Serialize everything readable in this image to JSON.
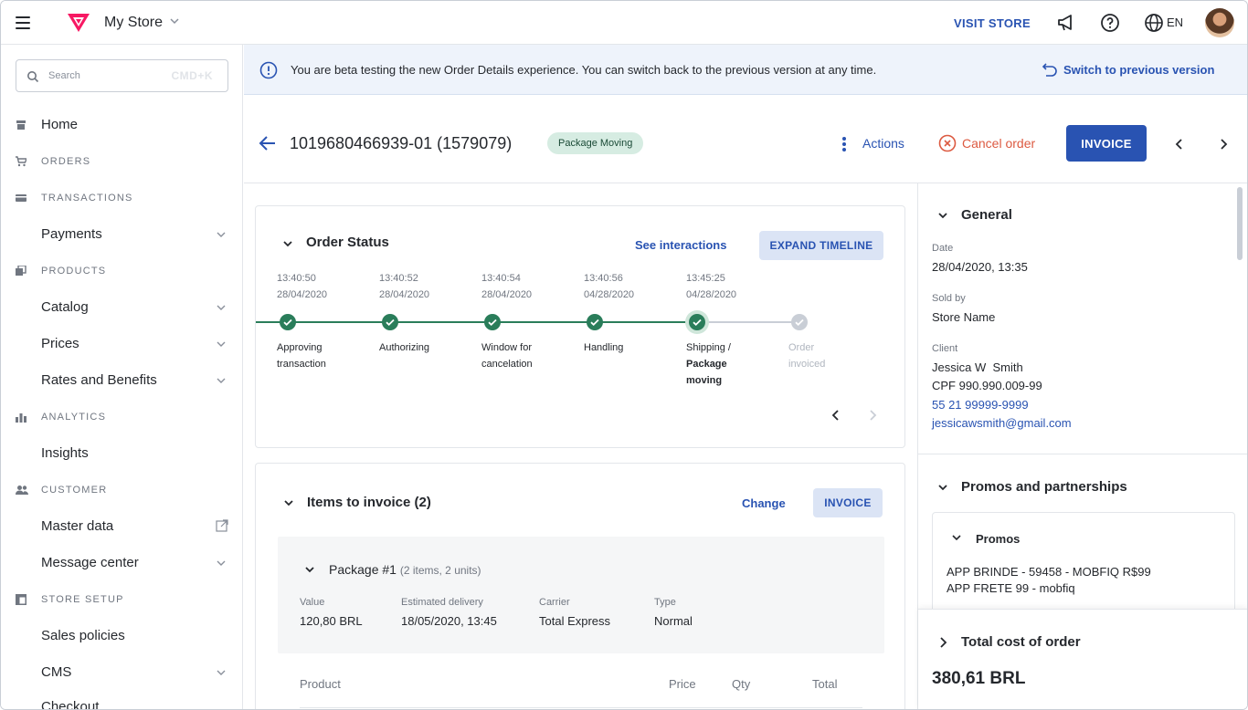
{
  "topbar": {
    "store_name": "My Store",
    "visit_store": "VISIT STORE",
    "lang": "EN"
  },
  "sidebar": {
    "search_placeholder": "Search",
    "search_shortcut": "CMD+K",
    "home": "Home",
    "sections": {
      "orders": "ORDERS",
      "transactions": "TRANSACTIONS",
      "products": "PRODUCTS",
      "analytics": "ANALYTICS",
      "customer": "CUSTOMER",
      "store_setup": "STORE SETUP"
    },
    "items": {
      "payments": "Payments",
      "catalog": "Catalog",
      "prices": "Prices",
      "rates": "Rates and Benefits",
      "insights": "Insights",
      "master_data": "Master data",
      "message_center": "Message center",
      "sales_policies": "Sales policies",
      "cms": "CMS",
      "checkout": "Checkout"
    }
  },
  "banner": {
    "message": "You are beta testing the new Order Details experience. You can switch back to the previous version at any time.",
    "switch_label": "Switch to previous version"
  },
  "header": {
    "order_id": "1019680466939-01 (1579079)",
    "status": "Package Moving",
    "actions": "Actions",
    "cancel": "Cancel order",
    "invoice": "INVOICE"
  },
  "order_status": {
    "title": "Order Status",
    "see_interactions": "See interactions",
    "expand_timeline": "EXPAND TIMELINE",
    "steps": [
      {
        "time": "13:40:50",
        "date": "28/04/2020",
        "label1": "Approving",
        "label2": "transaction",
        "label3": ""
      },
      {
        "time": "13:40:52",
        "date": "28/04/2020",
        "label1": "Authorizing",
        "label2": "",
        "label3": ""
      },
      {
        "time": "13:40:54",
        "date": "28/04/2020",
        "label1": "Window for",
        "label2": "cancelation",
        "label3": ""
      },
      {
        "time": "13:40:56",
        "date": "04/28/2020",
        "label1": "Handling",
        "label2": "",
        "label3": ""
      },
      {
        "time": "13:45:25",
        "date": "04/28/2020",
        "label1": "Shipping /",
        "label2": "Package",
        "label3": "moving"
      },
      {
        "time": "",
        "date": "",
        "label1": "Order",
        "label2": "invoiced",
        "label3": ""
      }
    ]
  },
  "items_to_invoice": {
    "title": "Items to invoice (2)",
    "change": "Change",
    "invoice": "INVOICE",
    "package": {
      "title": "Package #1",
      "subtitle": "(2 items, 2 units)",
      "value_label": "Value",
      "value": "120,80 BRL",
      "delivery_label": "Estimated delivery",
      "delivery": "18/05/2020, 13:45",
      "carrier_label": "Carrier",
      "carrier": "Total Express",
      "type_label": "Type",
      "type": "Normal"
    },
    "columns": [
      "Product",
      "Price",
      "Qty",
      "Total"
    ]
  },
  "general": {
    "title": "General",
    "date_label": "Date",
    "date": "28/04/2020, 13:35",
    "sold_by_label": "Sold by",
    "sold_by": "Store Name",
    "client_label": "Client",
    "client_name": "Jessica W  Smith",
    "client_cpf": "CPF 990.990.009-99",
    "client_phone": "55 21 99999-9999",
    "client_email": "jessicawsmith@gmail.com"
  },
  "promos": {
    "title": "Promos and partnerships",
    "sub_title": "Promos",
    "line1": "APP BRINDE - 59458 - MOBFIQ R$99",
    "line2": "APP FRETE 99 - mobfiq"
  },
  "total": {
    "title": "Total cost of order",
    "value": "380,61 BRL"
  },
  "colors": {
    "accent": "#2953b2",
    "success": "#2a7d5a",
    "danger": "#dc5a41"
  }
}
